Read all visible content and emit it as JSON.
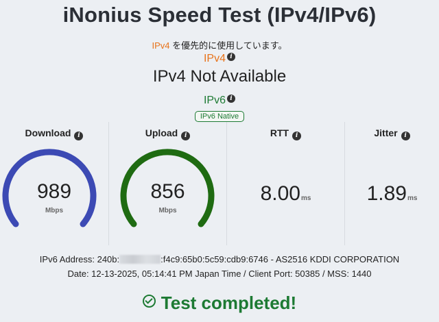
{
  "title": "iNonius Speed Test (IPv4/IPv6)",
  "preference": {
    "protocol": "IPv4",
    "text": " を優先的に使用しています。"
  },
  "ipv4": {
    "label": "IPv4",
    "status": "IPv4 Not Available",
    "color": "#e8731a"
  },
  "ipv6": {
    "label": "IPv6",
    "badge": "IPv6 Native",
    "color": "#1d7a33"
  },
  "info_icon": "info-icon",
  "metrics": {
    "download": {
      "label": "Download",
      "value": "989",
      "unit": "Mbps",
      "gauge_color": "#3c4ab4"
    },
    "upload": {
      "label": "Upload",
      "value": "856",
      "unit": "Mbps",
      "gauge_color": "#1f6b12"
    },
    "rtt": {
      "label": "RTT",
      "value": "8.00",
      "unit": "ms"
    },
    "jitter": {
      "label": "Jitter",
      "value": "1.89",
      "unit": "ms"
    }
  },
  "address_line": {
    "prefix": "IPv6 Address: 240b:",
    "suffix": ":f4c9:65b0:5c59:cdb9:6746 - AS2516 KDDI CORPORATION"
  },
  "date_line": "Date: 12-13-2025, 05:14:41 PM Japan Time / Client Port: 50385 / MSS: 1440",
  "status": "Test completed!"
}
